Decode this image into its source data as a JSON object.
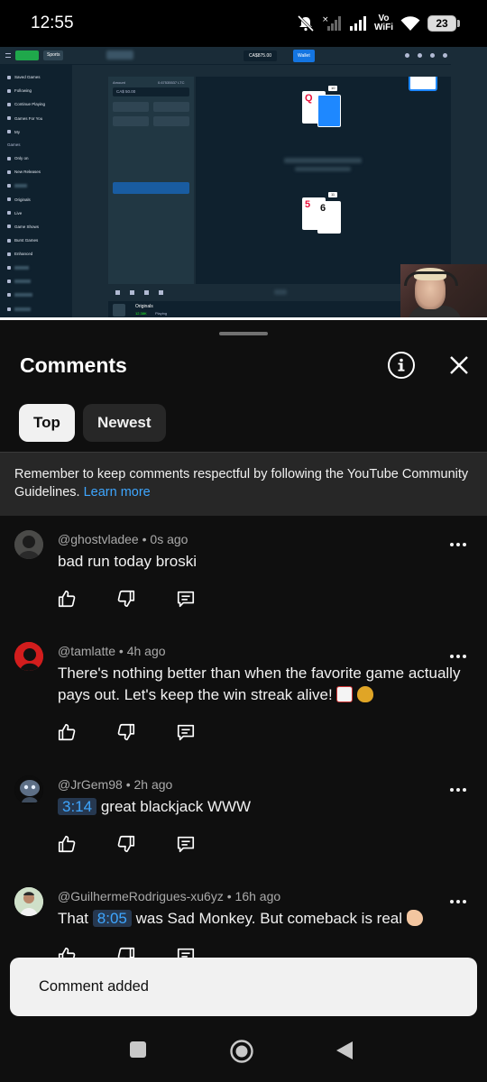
{
  "status_bar": {
    "time": "12:55",
    "network_label_top": "Vo",
    "network_label_bottom": "WiFi",
    "battery_level": "23",
    "icons": [
      "mute-icon",
      "signal-off-icon",
      "signal-icon",
      "wifi-icon",
      "battery-icon"
    ]
  },
  "video": {
    "top_nav": {
      "sports_label": "Sports",
      "balance": "CA$875.00",
      "wallet_label": "Wallet"
    },
    "sidebar_items": [
      "Saved Games",
      "Following",
      "Continue Playing",
      "Games For You",
      "My",
      "Games",
      "Only on",
      "New Releases",
      "",
      "Originals",
      "Live",
      "Game Shows",
      "Burst Games",
      "Enhanced",
      "",
      "",
      "",
      ""
    ],
    "panel": {
      "amount_label": "Amount",
      "amount_value": "0.67535537 LTC",
      "amount_currency": "CA$ 50.00"
    },
    "table": {
      "dealer_score": "10",
      "player_score": "11",
      "player_card_1": "5",
      "player_card_2": "6",
      "dealer_card_1": "Q"
    },
    "below": {
      "originals_label": "Originals",
      "playing_count": "12.38K",
      "playing_label": "Playing",
      "tag_label": "Sox"
    }
  },
  "comments_sheet": {
    "title": "Comments",
    "tabs": [
      {
        "label": "Top",
        "active": true
      },
      {
        "label": "Newest",
        "active": false
      }
    ],
    "notice": {
      "text": "Remember to keep comments respectful by following the YouTube Community Guidelines.",
      "link": "Learn more"
    },
    "comments": [
      {
        "author": "@ghostvladee",
        "age": "0s ago",
        "text": "bad run today broski"
      },
      {
        "author": "@tamlatte",
        "age": "4h ago",
        "text": "There's nothing better than when the favorite game actually pays out. Let's keep the win streak alive!",
        "emojis": [
          "playing-cards-emoji",
          "money-bag-emoji"
        ]
      },
      {
        "author": "@JrGem98",
        "age": "2h ago",
        "timestamp": "3:14",
        "text": "great blackjack WWW"
      },
      {
        "author": "@GuilhermeRodrigues-xu6yz",
        "age": "16h ago",
        "text_before": "That",
        "timestamp": "8:05",
        "text_after": "was Sad Monkey. But comeback is real",
        "emojis": [
          "flexed-biceps-emoji"
        ]
      }
    ],
    "separator": "•"
  },
  "toast": {
    "message": "Comment added"
  },
  "nav_bar": {
    "buttons": [
      "recents-button",
      "home-button",
      "back-button"
    ]
  },
  "colors": {
    "background": "#0f0f0f",
    "chip_active_bg": "#f1f1f1",
    "chip_inactive_bg": "#272727",
    "link": "#3ea6ff",
    "timestamp_bg": "#263850",
    "meta_text": "#aaaaaa"
  }
}
